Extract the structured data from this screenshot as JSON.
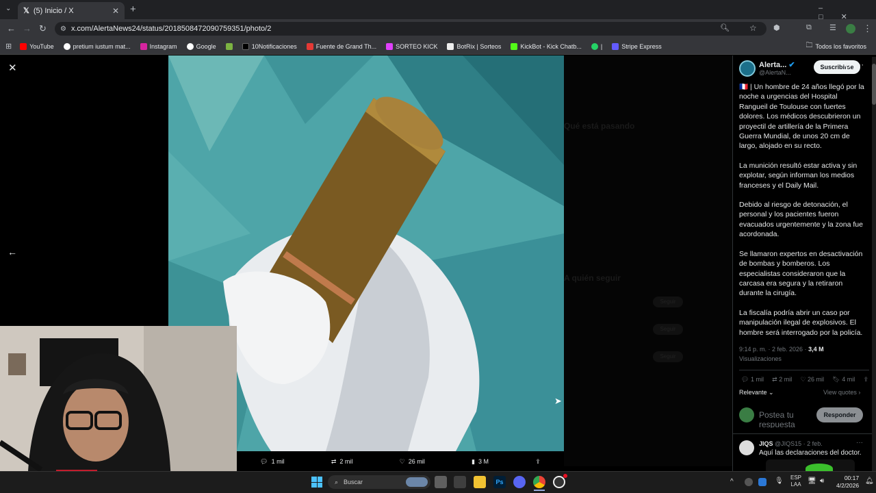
{
  "browser": {
    "tab_title": "(5) Inicio / X",
    "url": "x.com/AlertaNews24/status/2018508472090759351/photo/2",
    "bookmarks": [
      "YouTube",
      "pretium iustum mat...",
      "Instagram",
      "Google",
      "10Notificaciones",
      "Fuente de Grand Th...",
      "SORTEO KICK",
      "BotRix | Sorteos",
      "KickBot - Kick Chatb...",
      "|",
      "Stripe Express"
    ],
    "all_bookmarks": "Todos los favoritos"
  },
  "post": {
    "author_name": "Alerta...",
    "author_handle": "@AlertaN...",
    "subscribe_label": "Suscribirse",
    "paragraphs": [
      "🇫🇷 | Un hombre de 24 años llegó por la noche a urgencias del Hospital Rangueil de Toulouse con fuertes dolores. Los médicos descubrieron un proyectil de artillería de la Primera Guerra Mundial, de unos 20 cm de largo, alojado en su recto.",
      "La munición resultó estar activa y sin explotar, según informan los medios franceses y el Daily Mail.",
      "Debido al riesgo de detonación, el personal y los pacientes fueron evacuados urgentemente y la zona fue acordonada.",
      "Se llamaron expertos en desactivación de bombas y bomberos. Los especialistas consideraron que la carcasa era segura y la retiraron durante la cirugía.",
      "La fiscalía podría abrir un caso por manipulación ilegal de explosivos. El hombre será interrogado por la policía."
    ],
    "timestamp": "9:14 p. m. · 2 feb. 2026 ·",
    "views_count": "3,4 M",
    "views_label": "Visualizaciones",
    "replies": "1 mil",
    "reposts": "2 mil",
    "likes": "26 mil",
    "bookmarks": "4 mil",
    "sort_label": "Relevante",
    "view_quotes": "View quotes",
    "reply_placeholder": "Postea tu respuesta",
    "reply_button": "Responder",
    "reply_author": "JIQS",
    "reply_handle": "@JIQS15 · 2 feb.",
    "reply_text": "Aquí las declaraciones del doctor."
  },
  "photo_actions": {
    "replies": "1 mil",
    "reposts": "2 mil",
    "likes": "26 mil",
    "views": "3 M"
  },
  "background_text": {
    "happening": "Qué está pasando",
    "who_to_follow": "A quién seguir",
    "follow": "Seguir"
  },
  "taskbar": {
    "search_label": "Buscar",
    "lang": "ESP",
    "lang2": "LAA",
    "time": "00:17",
    "date": "4/2/2026"
  },
  "colors": {
    "accent": "#1d9bf0",
    "x_bg": "#000000",
    "taskbar": "#1c1c1c",
    "teal": "#4fa6aa"
  }
}
